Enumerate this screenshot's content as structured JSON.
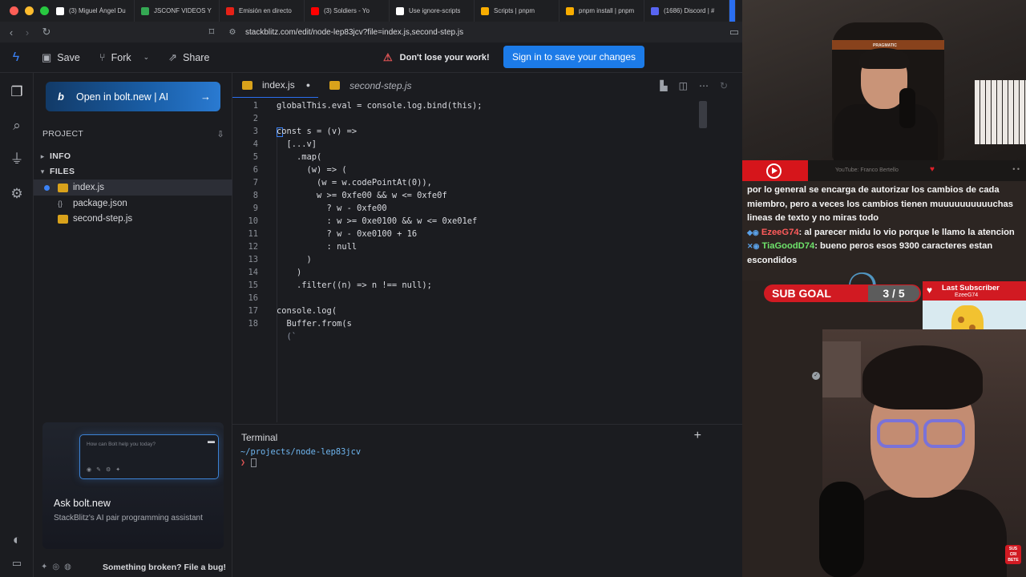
{
  "browser": {
    "tabs": [
      {
        "label": "(3) Miguel Ángel Du",
        "icon": "x-icon",
        "color": "#ffffff"
      },
      {
        "label": "JSCONF VIDEOS Y",
        "icon": "drive-icon",
        "color": "#34a853"
      },
      {
        "label": "Emisión en directo",
        "icon": "youtube-studio-icon",
        "color": "#e62117"
      },
      {
        "label": "(3) Soldiers - Yo",
        "icon": "youtube-icon",
        "color": "#ff0000"
      },
      {
        "label": "Use ignore-scripts",
        "icon": "github-icon",
        "color": "#ffffff"
      },
      {
        "label": "Scripts | pnpm",
        "icon": "pnpm-icon",
        "color": "#f9ad00"
      },
      {
        "label": "pnpm install | pnpm",
        "icon": "pnpm-icon",
        "color": "#f9ad00"
      },
      {
        "label": "(1686) Discord | #",
        "icon": "discord-icon",
        "color": "#5865f2"
      }
    ],
    "url": "stackblitz.com/edit/node-lep83jcv?file=index.js,second-step.js"
  },
  "header": {
    "save_label": "Save",
    "fork_label": "Fork",
    "share_label": "Share",
    "warning_text": "Don't lose your work!",
    "signin_label": "Sign in to save your changes"
  },
  "sidebar": {
    "bolt_cta": "Open in bolt.new | AI",
    "project_label": "PROJECT",
    "info_label": "INFO",
    "files_label": "FILES",
    "files": [
      {
        "name": "index.js",
        "type": "js",
        "selected": true
      },
      {
        "name": "package.json",
        "type": "json",
        "selected": false
      },
      {
        "name": "second-step.js",
        "type": "js",
        "selected": false
      }
    ],
    "ask_placeholder": "How can Bolt help you today?",
    "ask_title": "Ask bolt.new",
    "ask_subtitle": "StackBlitz's AI pair programming assistant",
    "footer_bug": "Something broken? File a bug!"
  },
  "editor": {
    "tabs": [
      {
        "label": "index.js",
        "modified": true,
        "active": true
      },
      {
        "label": "second-step.js",
        "modified": false,
        "active": false
      }
    ],
    "lines": [
      "globalThis.eval = console.log.bind(this);",
      "",
      "const s = (v) =>",
      "  [...v]",
      "    .map(",
      "      (w) => (",
      "        (w = w.codePointAt(0)),",
      "        w >= 0xfe00 && w <= 0xfe0f",
      "          ? w - 0xfe00",
      "          : w >= 0xe0100 && w <= 0xe01ef",
      "          ? w - 0xe0100 + 16",
      "          : null",
      "      )",
      "    )",
      "    .filter((n) => n !== null);",
      "",
      "console.log(",
      "  Buffer.from(s"
    ],
    "trailing_line": "  (`",
    "line_numbers": [
      "1",
      "2",
      "3",
      "4",
      "5",
      "6",
      "7",
      "8",
      "9",
      "10",
      "11",
      "12",
      "13",
      "14",
      "15",
      "16",
      "17",
      "18"
    ]
  },
  "terminal": {
    "title": "Terminal",
    "path": "~/projects/node-lep83jcv",
    "prompt": "❯"
  },
  "stream": {
    "chair_brand": "PRAGMATIC",
    "yt_channel": "YouTube: Franco Bertello",
    "chat": {
      "line1": "por lo general se encarga de autorizar los cambios de cada miembro, pero a veces los cambios tienen muuuuuuuuuuchas lineas de texto y no miras todo",
      "user1": "EzeeG74",
      "msg1": ": al parecer midu lo vio porque le llamo la atencion",
      "user2": "TiaGoodD74",
      "msg2": ": bueno peros esos 9300 caracteres estan escondidos"
    },
    "sub_goal_label": "SUB GOAL",
    "sub_goal_value": "3 / 5",
    "last_sub_title": "Last Subscriber",
    "last_sub_name": "EzeeG74",
    "subscribe_text": "SUS CRI BETE"
  },
  "colors": {
    "accent": "#2b6ff0",
    "signin_bg": "#1c7be8",
    "warning": "#e25555",
    "stream_red": "#d11a22"
  }
}
